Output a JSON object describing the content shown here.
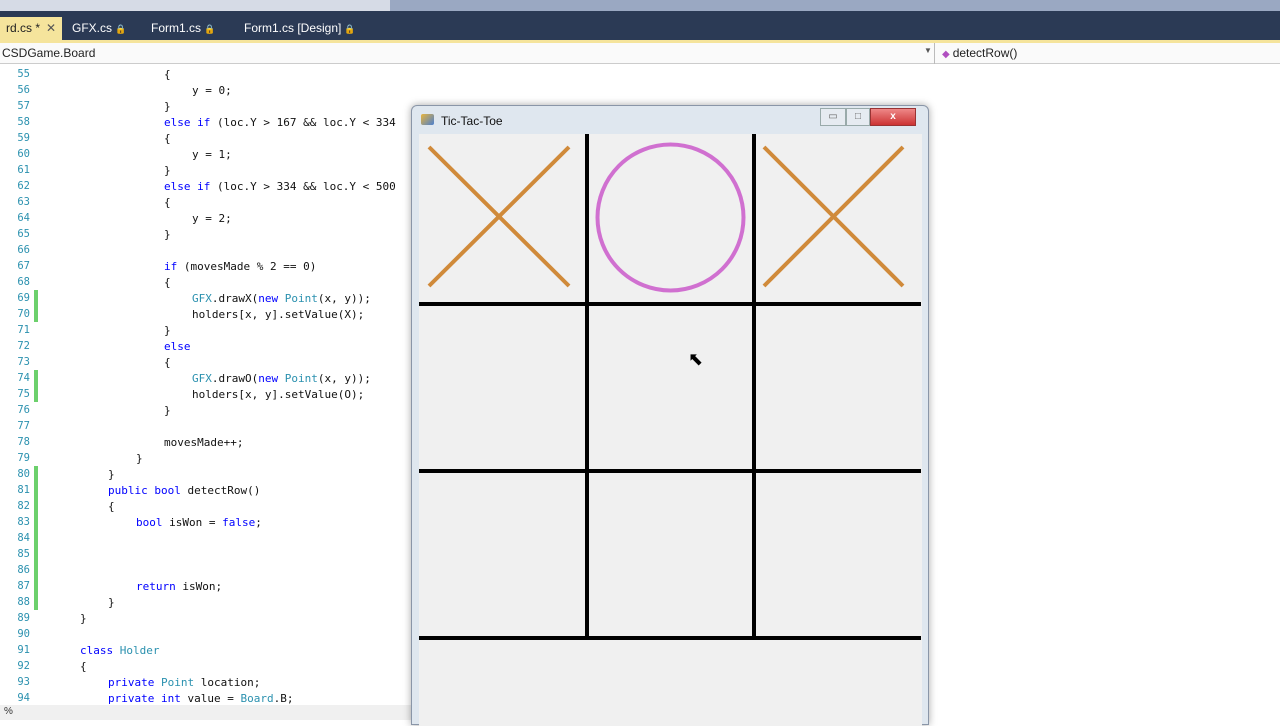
{
  "tabs": [
    {
      "label": "rd.cs",
      "active": true,
      "modified": "*",
      "close": "✕"
    },
    {
      "label": "GFX.cs",
      "lock": "🔒"
    },
    {
      "label": "Form1.cs",
      "lock": "🔒"
    },
    {
      "label": "Form1.cs [Design]",
      "lock": "🔒"
    }
  ],
  "navbar": {
    "class_selector": "CSDGame.Board",
    "member_selector": "detectRow()"
  },
  "code": [
    {
      "n": "55",
      "i": 16,
      "t": [
        [
          "{",
          ""
        ]
      ]
    },
    {
      "n": "56",
      "i": 20,
      "t": [
        [
          "y = 0;",
          ""
        ]
      ]
    },
    {
      "n": "57",
      "i": 16,
      "t": [
        [
          "}",
          ""
        ]
      ]
    },
    {
      "n": "58",
      "i": 16,
      "t": [
        [
          "else if",
          "kw"
        ],
        [
          " (loc.Y > 167 && loc.Y < 334",
          ""
        ]
      ]
    },
    {
      "n": "59",
      "i": 16,
      "t": [
        [
          "{",
          ""
        ]
      ]
    },
    {
      "n": "60",
      "i": 20,
      "t": [
        [
          "y = 1;",
          ""
        ]
      ]
    },
    {
      "n": "61",
      "i": 16,
      "t": [
        [
          "}",
          ""
        ]
      ]
    },
    {
      "n": "62",
      "i": 16,
      "t": [
        [
          "else if",
          "kw"
        ],
        [
          " (loc.Y > 334 && loc.Y < 500",
          ""
        ]
      ]
    },
    {
      "n": "63",
      "i": 16,
      "t": [
        [
          "{",
          ""
        ]
      ]
    },
    {
      "n": "64",
      "i": 20,
      "t": [
        [
          "y = 2;",
          ""
        ]
      ]
    },
    {
      "n": "65",
      "i": 16,
      "t": [
        [
          "}",
          ""
        ]
      ]
    },
    {
      "n": "66",
      "i": 0,
      "t": []
    },
    {
      "n": "67",
      "i": 16,
      "t": [
        [
          "if",
          "kw"
        ],
        [
          " (movesMade % 2 == 0)",
          ""
        ]
      ]
    },
    {
      "n": "68",
      "i": 16,
      "t": [
        [
          "{",
          ""
        ]
      ]
    },
    {
      "n": "69",
      "i": 20,
      "c": true,
      "t": [
        [
          "GFX",
          "ty"
        ],
        [
          ".drawX(",
          ""
        ],
        [
          "new",
          "kw"
        ],
        [
          " ",
          ""
        ],
        [
          "Point",
          "ty"
        ],
        [
          "(x, y));",
          ""
        ]
      ]
    },
    {
      "n": "70",
      "i": 20,
      "c": true,
      "t": [
        [
          "holders[x, y].setValue(X);",
          ""
        ]
      ]
    },
    {
      "n": "71",
      "i": 16,
      "t": [
        [
          "}",
          ""
        ]
      ]
    },
    {
      "n": "72",
      "i": 16,
      "t": [
        [
          "else",
          "kw"
        ]
      ]
    },
    {
      "n": "73",
      "i": 16,
      "t": [
        [
          "{",
          ""
        ]
      ]
    },
    {
      "n": "74",
      "i": 20,
      "c": true,
      "t": [
        [
          "GFX",
          "ty"
        ],
        [
          ".drawO(",
          ""
        ],
        [
          "new",
          "kw"
        ],
        [
          " ",
          ""
        ],
        [
          "Point",
          "ty"
        ],
        [
          "(x, y));",
          ""
        ]
      ]
    },
    {
      "n": "75",
      "i": 20,
      "c": true,
      "t": [
        [
          "holders[x, y].setValue(O);",
          ""
        ]
      ]
    },
    {
      "n": "76",
      "i": 16,
      "t": [
        [
          "}",
          ""
        ]
      ]
    },
    {
      "n": "77",
      "i": 0,
      "t": []
    },
    {
      "n": "78",
      "i": 16,
      "t": [
        [
          "movesMade++;",
          ""
        ]
      ]
    },
    {
      "n": "79",
      "i": 12,
      "t": [
        [
          "}",
          ""
        ]
      ]
    },
    {
      "n": "80",
      "i": 8,
      "c": true,
      "t": [
        [
          "}",
          ""
        ]
      ]
    },
    {
      "n": "81",
      "i": 8,
      "c": true,
      "t": [
        [
          "public",
          "kw"
        ],
        [
          " ",
          ""
        ],
        [
          "bool",
          "kw"
        ],
        [
          " detectRow()",
          ""
        ]
      ]
    },
    {
      "n": "82",
      "i": 8,
      "c": true,
      "t": [
        [
          "{",
          ""
        ]
      ]
    },
    {
      "n": "83",
      "i": 12,
      "c": true,
      "t": [
        [
          "bool",
          "kw"
        ],
        [
          " isWon = ",
          ""
        ],
        [
          "false",
          "kw"
        ],
        [
          ";",
          ""
        ]
      ]
    },
    {
      "n": "84",
      "i": 0,
      "c": true,
      "t": []
    },
    {
      "n": "85",
      "i": 0,
      "c": true,
      "t": []
    },
    {
      "n": "86",
      "i": 0,
      "c": true,
      "t": []
    },
    {
      "n": "87",
      "i": 12,
      "c": true,
      "t": [
        [
          "return",
          "kw"
        ],
        [
          " isWon;",
          ""
        ]
      ]
    },
    {
      "n": "88",
      "i": 8,
      "c": true,
      "t": [
        [
          "}",
          ""
        ]
      ]
    },
    {
      "n": "89",
      "i": 4,
      "t": [
        [
          "}",
          ""
        ]
      ]
    },
    {
      "n": "90",
      "i": 0,
      "t": []
    },
    {
      "n": "91",
      "i": 4,
      "t": [
        [
          "class",
          "kw"
        ],
        [
          " ",
          ""
        ],
        [
          "Holder",
          "ty"
        ]
      ]
    },
    {
      "n": "92",
      "i": 4,
      "t": [
        [
          "{",
          ""
        ]
      ]
    },
    {
      "n": "93",
      "i": 8,
      "t": [
        [
          "private",
          "kw"
        ],
        [
          " ",
          ""
        ],
        [
          "Point",
          "ty"
        ],
        [
          " location;",
          ""
        ]
      ]
    },
    {
      "n": "94",
      "i": 8,
      "t": [
        [
          "private",
          "kw"
        ],
        [
          " ",
          ""
        ],
        [
          "int",
          "kw"
        ],
        [
          " value = ",
          ""
        ],
        [
          "Board",
          "ty"
        ],
        [
          ".B;",
          ""
        ]
      ]
    }
  ],
  "status": {
    "zoom": "%"
  },
  "form": {
    "title": "Tic-Tac-Toe",
    "minimize": "▭",
    "maximize": "□",
    "close": "x",
    "board": [
      [
        "X",
        "O",
        "X"
      ],
      [
        "",
        "",
        ""
      ],
      [
        "",
        "",
        ""
      ]
    ],
    "colors": {
      "x": "#d08a3a",
      "o": "#d070d0",
      "grid": "#000000"
    }
  }
}
